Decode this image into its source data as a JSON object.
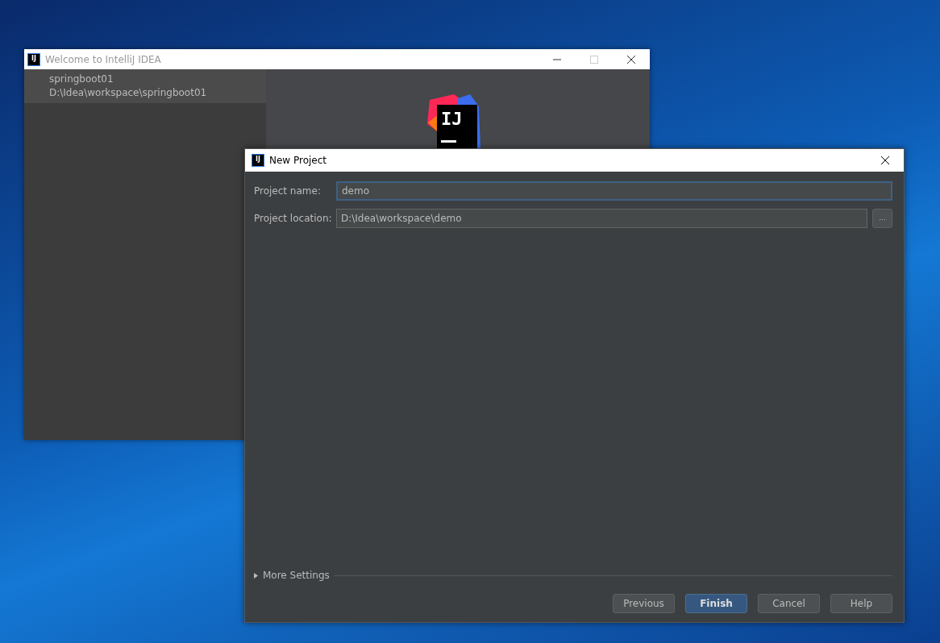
{
  "welcome_window": {
    "title": "Welcome to IntelliJ IDEA",
    "icon_text": "IJ",
    "logo_text": "IJ",
    "controls": [
      {
        "kind": "minimize",
        "disabled": false
      },
      {
        "kind": "maximize",
        "disabled": true
      },
      {
        "kind": "close",
        "disabled": false
      }
    ],
    "recent_projects": [
      {
        "name": "springboot01",
        "path": "D:\\Idea\\workspace\\springboot01",
        "selected": true
      }
    ]
  },
  "new_project_dialog": {
    "title": "New Project",
    "icon_text": "IJ",
    "fields": [
      {
        "label": "Project name:",
        "value": "demo",
        "focused": true
      },
      {
        "label": "Project location:",
        "value": "D:\\Idea\\workspace\\demo",
        "focused": false,
        "browse": "..."
      }
    ],
    "more_settings": {
      "label": "More Settings",
      "expanded": false
    },
    "buttons": [
      {
        "label": "Previous",
        "default": false
      },
      {
        "label": "Finish",
        "default": true
      },
      {
        "label": "Cancel",
        "default": false
      },
      {
        "label": "Help",
        "default": false
      }
    ]
  }
}
